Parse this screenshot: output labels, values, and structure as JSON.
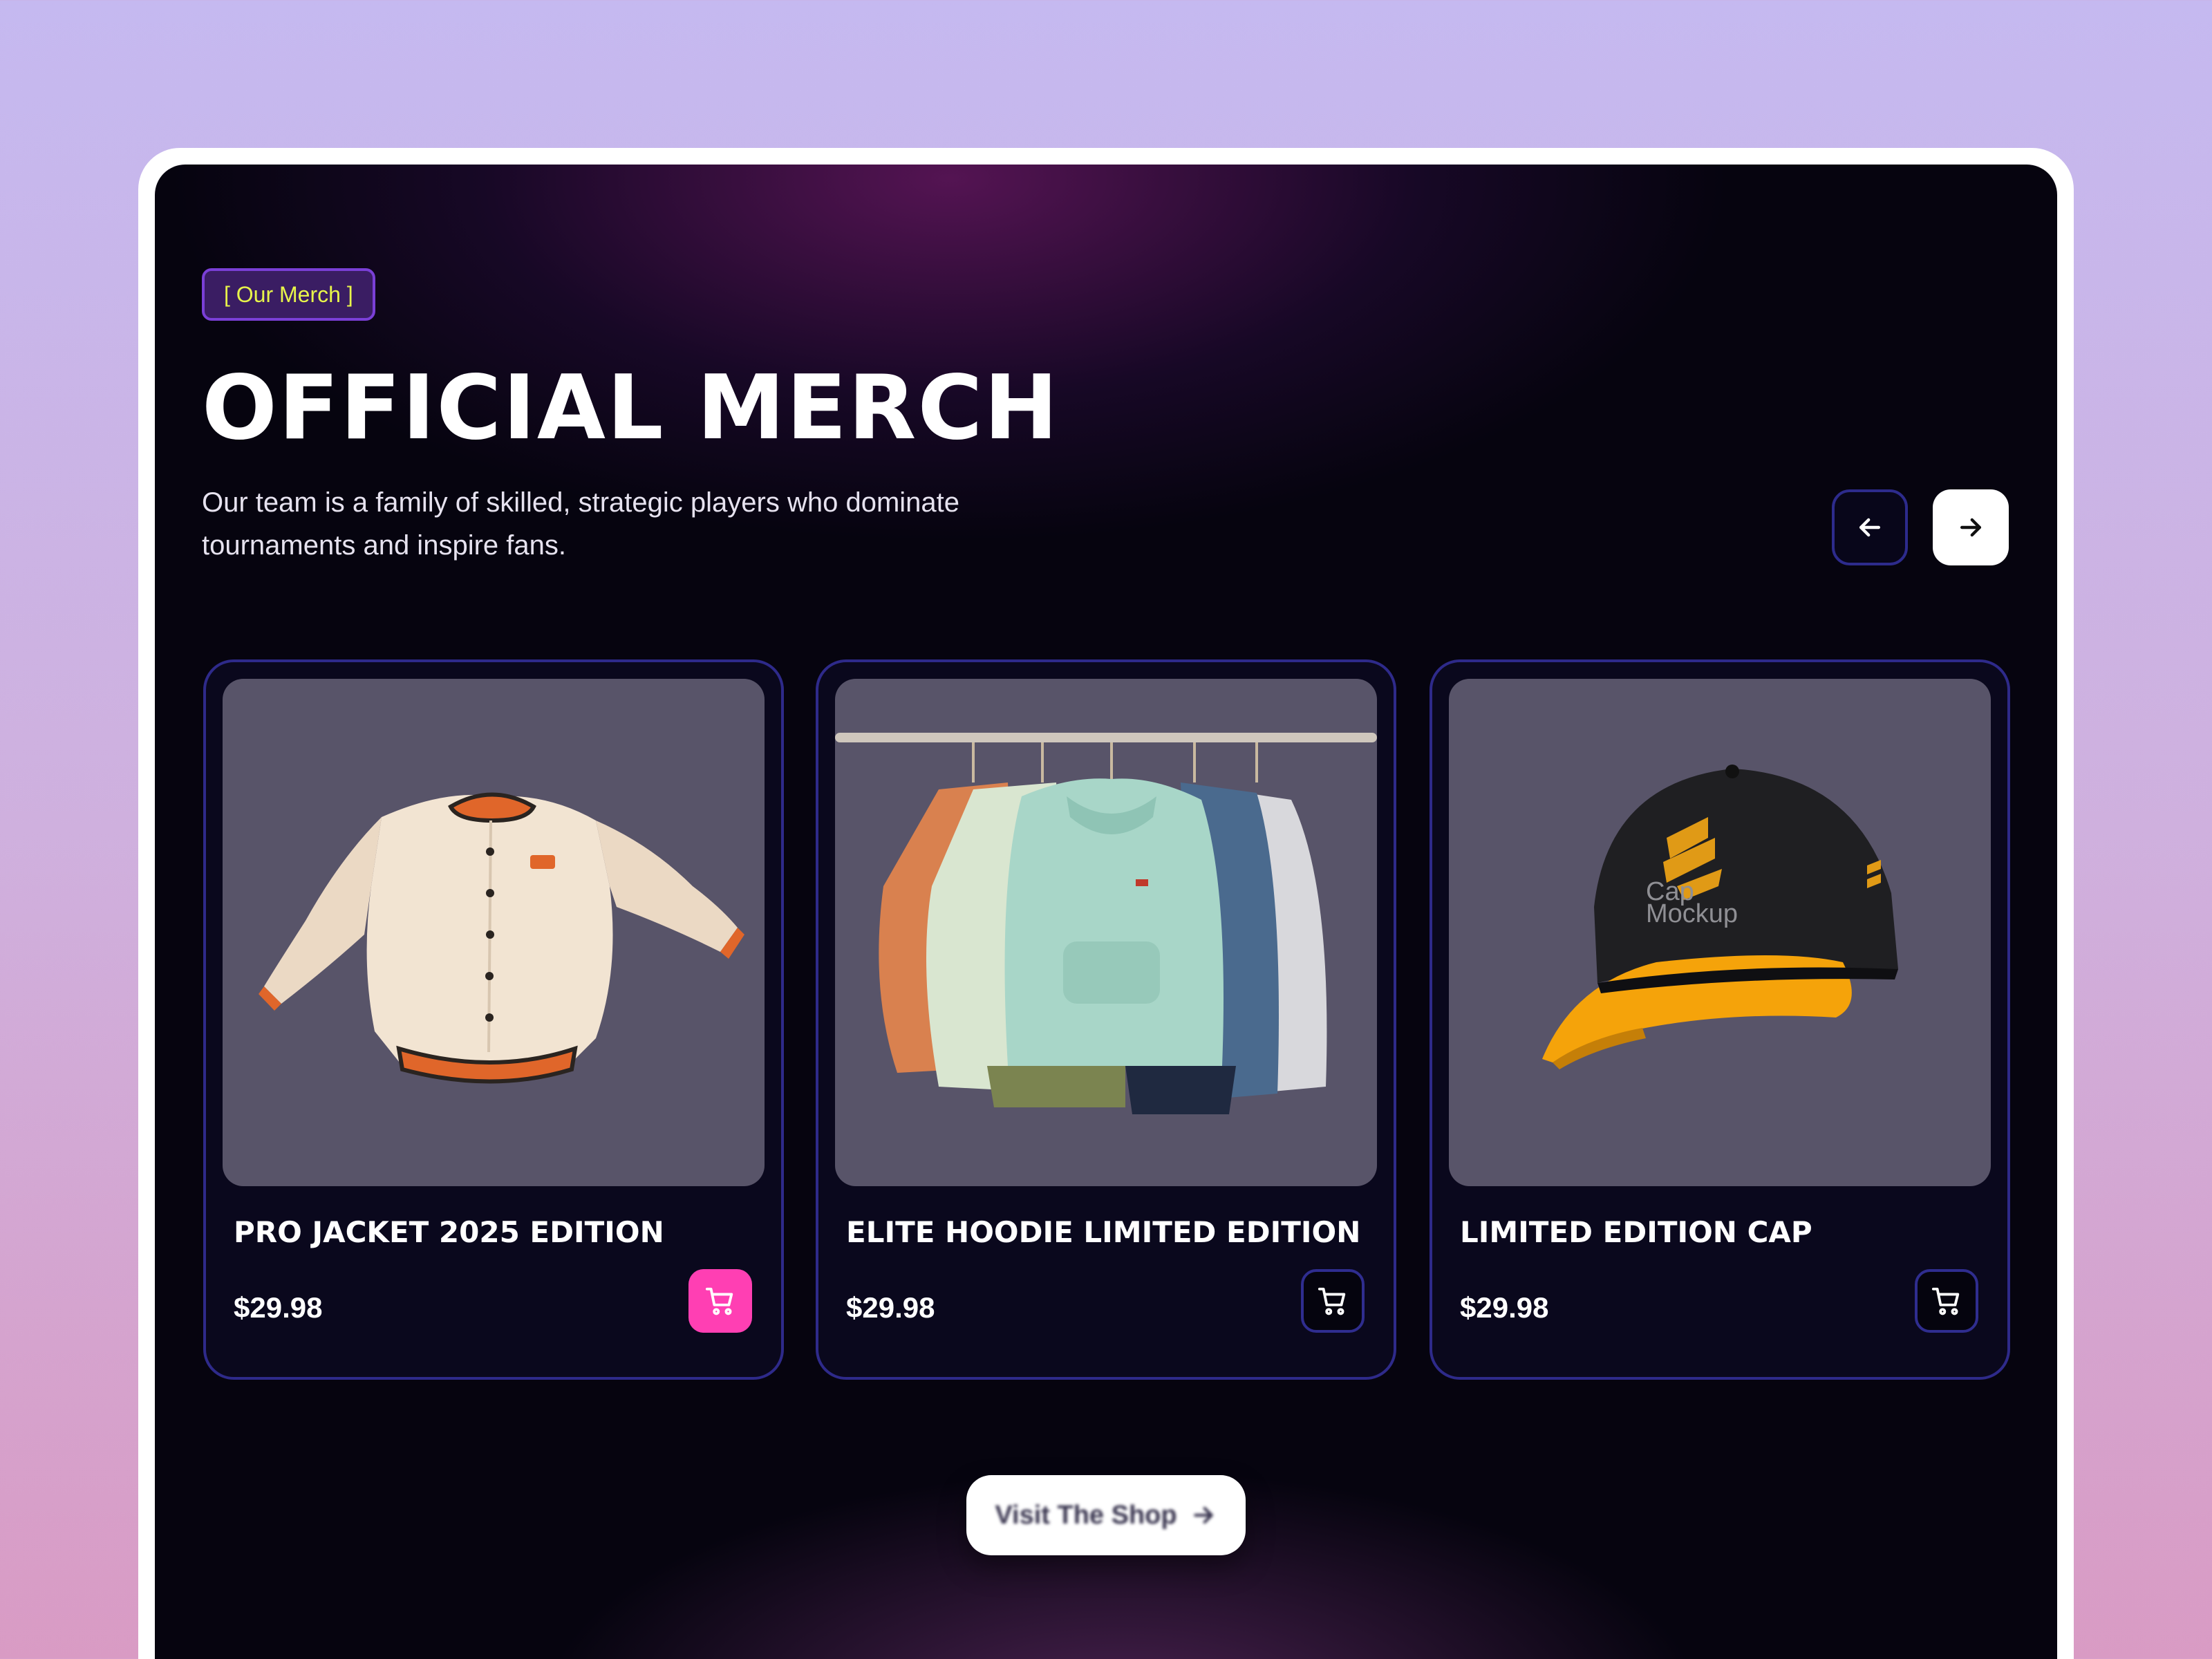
{
  "header": {
    "tag": "[ Our Merch ]",
    "title": "OFFICIAL MERCH",
    "description": "Our team is a family of skilled, strategic players who dominate tournaments and inspire fans."
  },
  "navigation": {
    "prev_icon": "arrow-left-icon",
    "next_icon": "arrow-right-icon"
  },
  "products": [
    {
      "name": "PRO JACKET 2025 EDITION",
      "price": "$29.98",
      "image": "varsity-jacket",
      "cart_highlighted": true
    },
    {
      "name": "ELITE HOODIE LIMITED EDITION",
      "price": "$29.98",
      "image": "hoodies-on-rack",
      "cart_highlighted": false
    },
    {
      "name": "LIMITED EDITION CAP",
      "price": "$29.98",
      "image": "cap-mockup",
      "cart_highlighted": false
    }
  ],
  "cap_mockup": {
    "line1": "Cap",
    "line2": "Mockup"
  },
  "cta": {
    "label": "Visit The Shop",
    "icon": "arrow-right-icon"
  },
  "colors": {
    "accent_pink": "#ff3fb3",
    "tag_text": "#e8f54a",
    "card_border": "#2e2a8a",
    "panel_bg": "#06040f"
  }
}
